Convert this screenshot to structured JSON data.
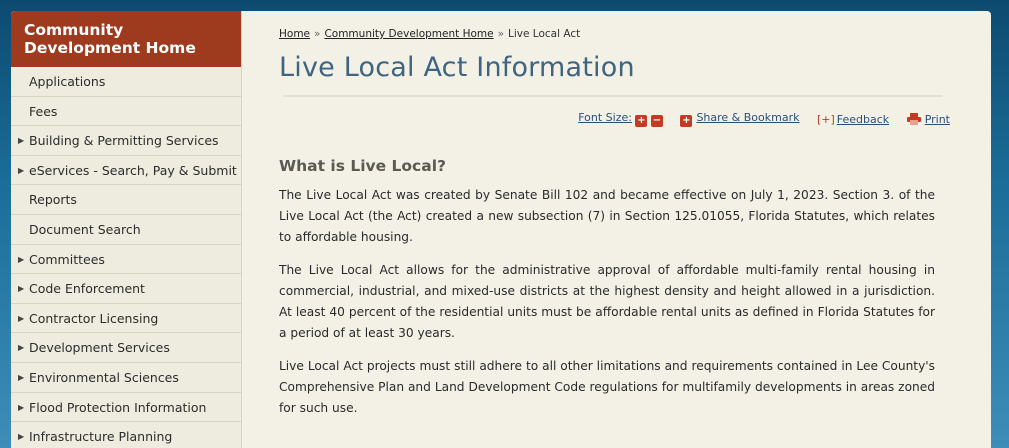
{
  "sidebar": {
    "header": "Community Development Home",
    "items": [
      {
        "label": "Applications",
        "expandable": false
      },
      {
        "label": "Fees",
        "expandable": false
      },
      {
        "label": "Building & Permitting Services",
        "expandable": true
      },
      {
        "label": "eServices - Search, Pay & Submit",
        "expandable": true
      },
      {
        "label": "Reports",
        "expandable": false
      },
      {
        "label": "Document Search",
        "expandable": false
      },
      {
        "label": "Committees",
        "expandable": true
      },
      {
        "label": "Code Enforcement",
        "expandable": true
      },
      {
        "label": "Contractor Licensing",
        "expandable": true
      },
      {
        "label": "Development Services",
        "expandable": true
      },
      {
        "label": "Environmental Sciences",
        "expandable": true
      },
      {
        "label": "Flood Protection Information",
        "expandable": true
      },
      {
        "label": "Infrastructure Planning",
        "expandable": true
      }
    ]
  },
  "breadcrumb": {
    "home": "Home",
    "separator": "»",
    "parent": "Community Development Home",
    "current": "Live Local Act"
  },
  "page_title": "Live Local Act Information",
  "toolbar": {
    "font_size_label": "Font Size:",
    "share_label": "Share & Bookmark",
    "feedback_mark": "[+]",
    "feedback_label": "Feedback",
    "print_label": "Print"
  },
  "content": {
    "heading": "What is Live Local?",
    "paragraphs": [
      "The Live Local Act was created by Senate Bill 102 and became effective on July 1, 2023. Section 3. of the Live Local Act (the Act) created a new subsection (7) in Section 125.01055, Florida Statutes, which relates to affordable housing.",
      "The Live Local Act allows for the administrative approval of affordable multi-family rental housing in commercial, industrial, and mixed-use districts at the highest density and height allowed in a jurisdiction. At least 40 percent of the residential units must be affordable rental units as defined in Florida Statutes for a period of at least 30 years.",
      "Live Local Act projects must still adhere to all other limitations and requirements contained in Lee County's Comprehensive Plan and Land Development Code regulations for multifamily developments in areas zoned for such use."
    ]
  },
  "colors": {
    "sidebar_header_bg": "#9e3b1f",
    "title_color": "#3f6481",
    "link_color": "#2b4f78",
    "icon_red": "#c23b22",
    "page_bg": "#f3f1e6"
  }
}
